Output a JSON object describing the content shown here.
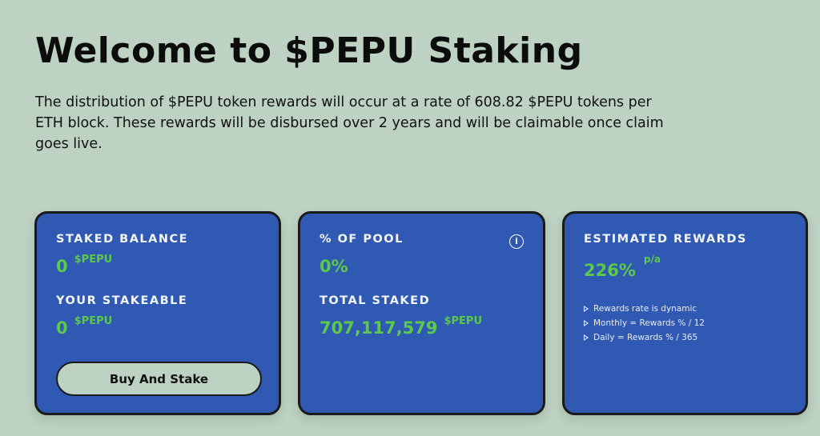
{
  "header": {
    "title": "Welcome to $PEPU Staking",
    "intro": "The distribution of $PEPU token rewards will occur at a rate of 608.82 $PEPU tokens per ETH block. These rewards will be disbursed over 2 years and will be claimable once claim goes live."
  },
  "cards": {
    "staked": {
      "label": "STAKED BALANCE",
      "value": "0",
      "unit": "$PEPU",
      "stakeable_label": "YOUR STAKEABLE",
      "stakeable_value": "0",
      "stakeable_unit": "$PEPU",
      "button_label": "Buy And Stake"
    },
    "pool": {
      "label": "% OF POOL",
      "value": "0%",
      "info_icon": "i",
      "total_label": "TOTAL STAKED",
      "total_value": "707,117,579",
      "total_unit": "$PEPU"
    },
    "rewards": {
      "label": "ESTIMATED REWARDS",
      "value": "226%",
      "suffix": "p/a",
      "notes": [
        "Rewards rate is dynamic",
        "Monthly = Rewards % / 12",
        "Daily = Rewards % / 365"
      ]
    }
  },
  "colors": {
    "background": "#bdd2c2",
    "card": "#2f59b3",
    "accent_green": "#5cc94d",
    "border": "#1a1a1a"
  }
}
